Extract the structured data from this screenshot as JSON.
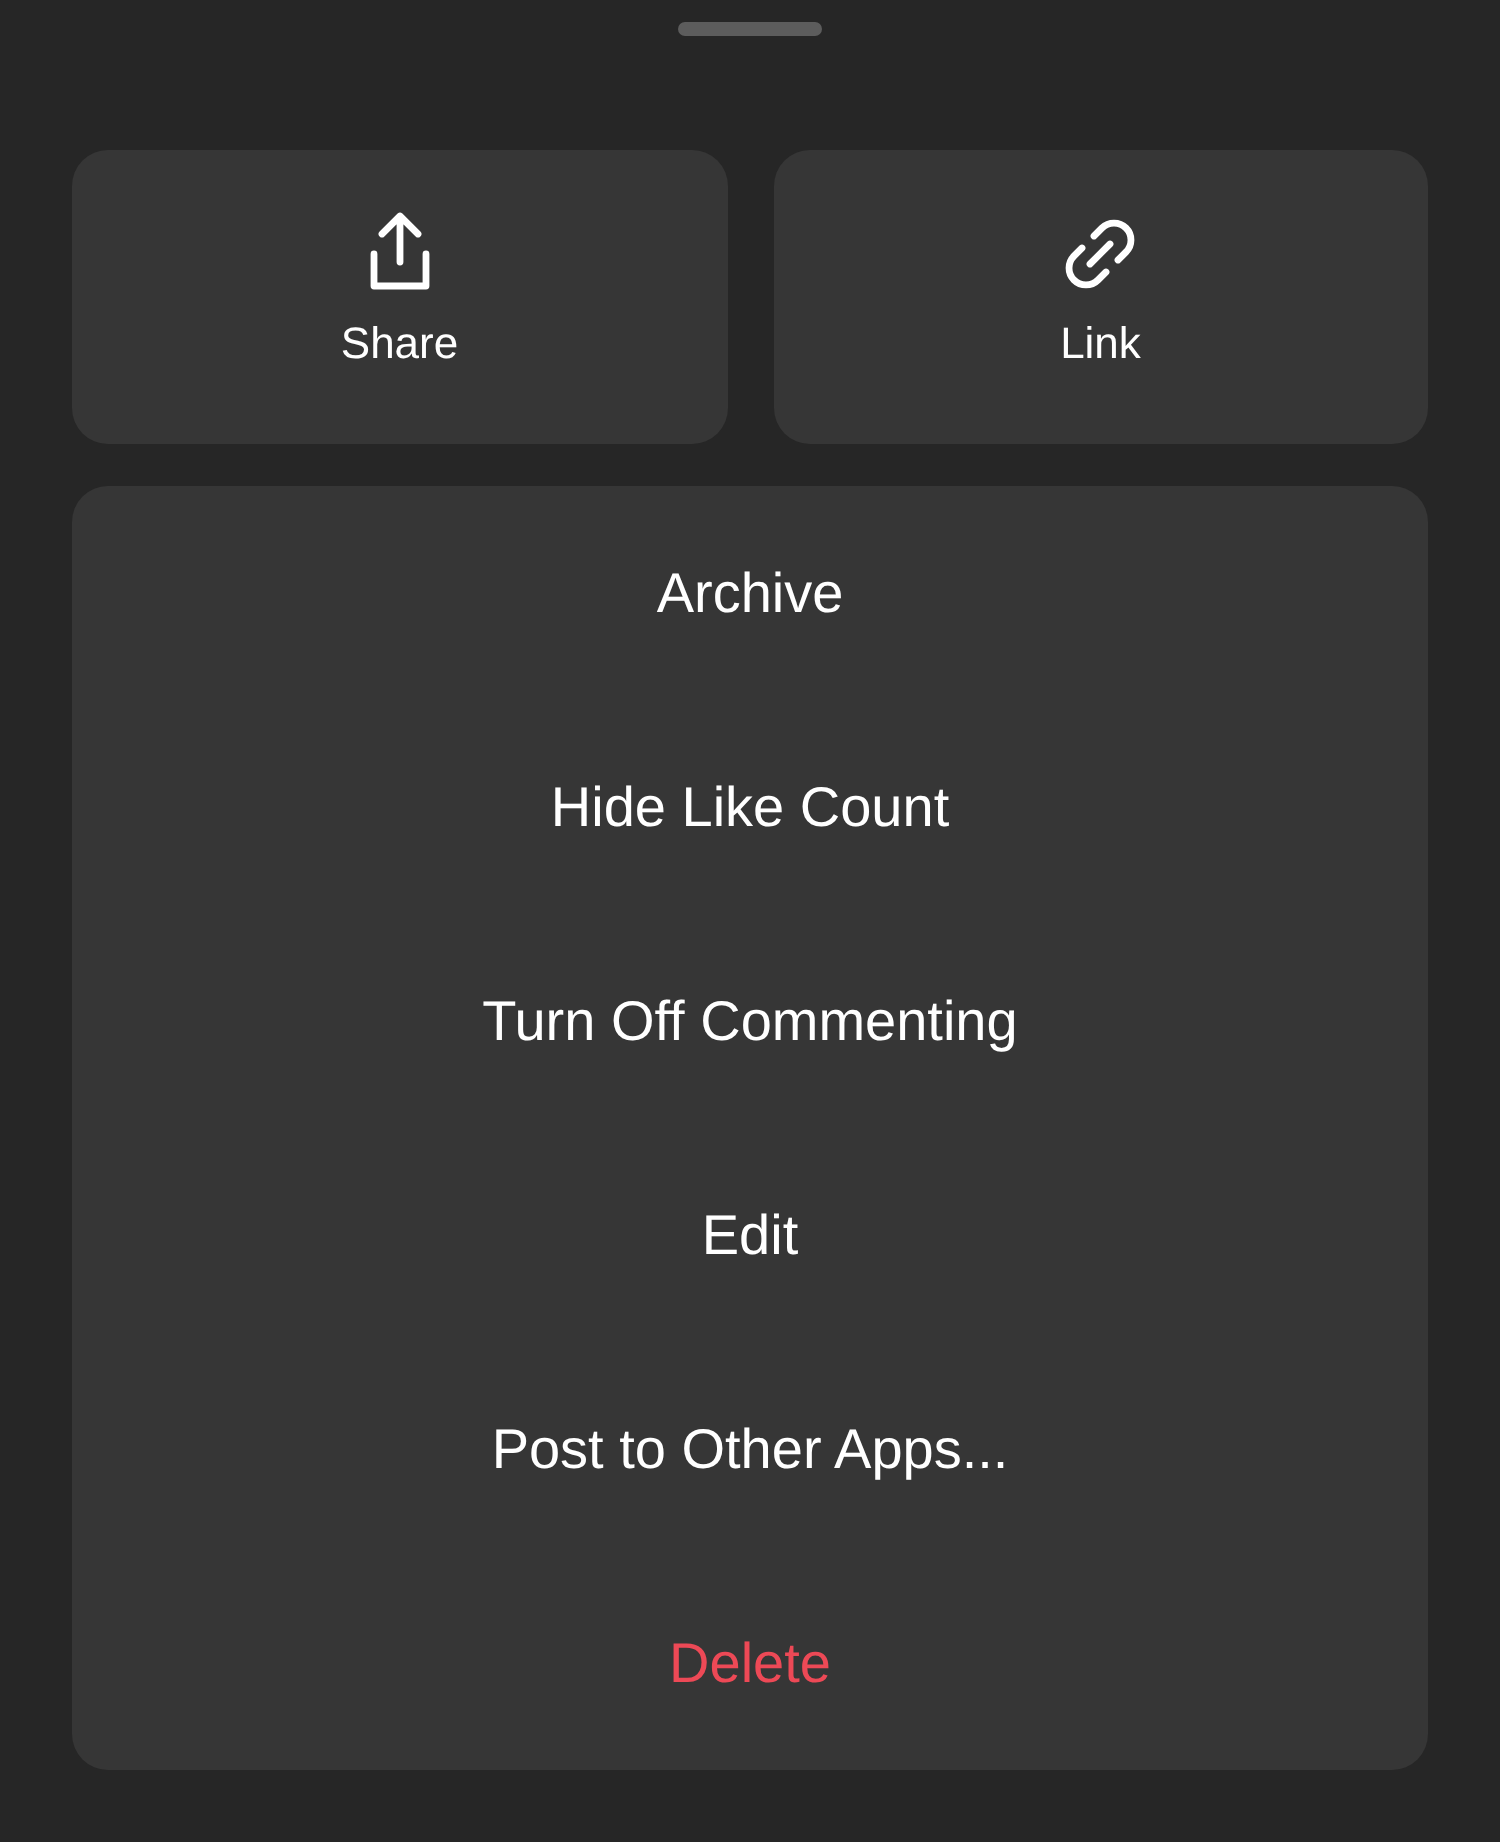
{
  "quick_actions": [
    {
      "kind": "share",
      "label": "Share"
    },
    {
      "kind": "link",
      "label": "Link"
    }
  ],
  "menu": [
    {
      "label": "Archive",
      "kind": "normal"
    },
    {
      "label": "Hide Like Count",
      "kind": "normal"
    },
    {
      "label": "Turn Off Commenting",
      "kind": "normal"
    },
    {
      "label": "Edit",
      "kind": "normal"
    },
    {
      "label": "Post to Other Apps...",
      "kind": "normal"
    },
    {
      "label": "Delete",
      "kind": "destructive"
    }
  ]
}
